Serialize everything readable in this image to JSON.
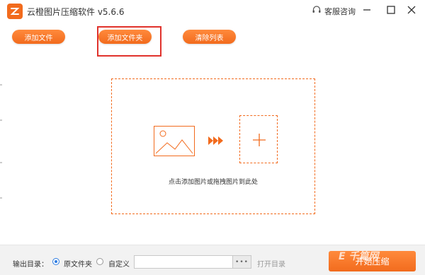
{
  "window": {
    "title": "云橙图片压缩软件 v5.6.6",
    "support_label": "客服咨询"
  },
  "toolbar": {
    "add_file": "添加文件",
    "add_folder": "添加文件夹",
    "clear_list": "清除列表"
  },
  "dropzone": {
    "hint": "点击添加图片或拖拽图片到此处"
  },
  "bottom": {
    "output_label": "输出目录：",
    "option_original": "原文件夹",
    "option_custom": "自定义",
    "path_value": "",
    "browse_label": "•••",
    "open_dir": "打开目录",
    "start_label": "开始压缩",
    "selected_option": "原文件夹"
  },
  "watermark": "E 千篇网",
  "colors": {
    "accent": "#f26b1d",
    "highlight": "#e0322c",
    "radio": "#2f7de1"
  }
}
